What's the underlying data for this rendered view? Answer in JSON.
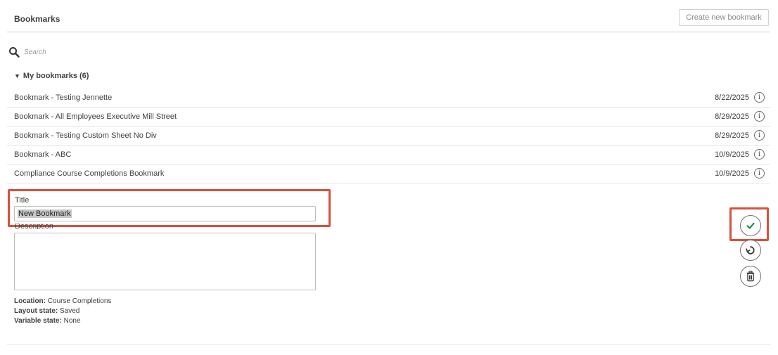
{
  "header": {
    "title": "Bookmarks",
    "create_button_label": "Create new bookmark"
  },
  "search": {
    "placeholder": "Search",
    "icon": "search-icon"
  },
  "group": {
    "caret": "▼",
    "label": "My bookmarks (6)"
  },
  "bookmarks": [
    {
      "name": "Bookmark - Testing Jennette",
      "date": "8/22/2025",
      "info_icon": "i"
    },
    {
      "name": "Bookmark - All Employees Executive Mill Street",
      "date": "8/29/2025",
      "info_icon": "i"
    },
    {
      "name": "Bookmark - Testing Custom Sheet No Div",
      "date": "8/29/2025",
      "info_icon": "i"
    },
    {
      "name": "Bookmark - ABC",
      "date": "10/9/2025",
      "info_icon": "i"
    },
    {
      "name": "Compliance Course Completions Bookmark",
      "date": "10/9/2025",
      "info_icon": "i"
    }
  ],
  "form": {
    "title_label": "Title",
    "title_value": "New Bookmark",
    "description_label": "Description",
    "description_value": "",
    "location_label": "Location:",
    "location_value": "Course Completions",
    "layout_label": "Layout state:",
    "layout_value": "Saved",
    "variable_label": "Variable state:",
    "variable_value": "None"
  },
  "actions": {
    "confirm_icon": "check-icon",
    "revert_icon": "revert-icon",
    "delete_icon": "trash-icon"
  },
  "colors": {
    "highlight": "#d9503f",
    "confirm_check": "#1e8f4a",
    "text": "#404040"
  }
}
